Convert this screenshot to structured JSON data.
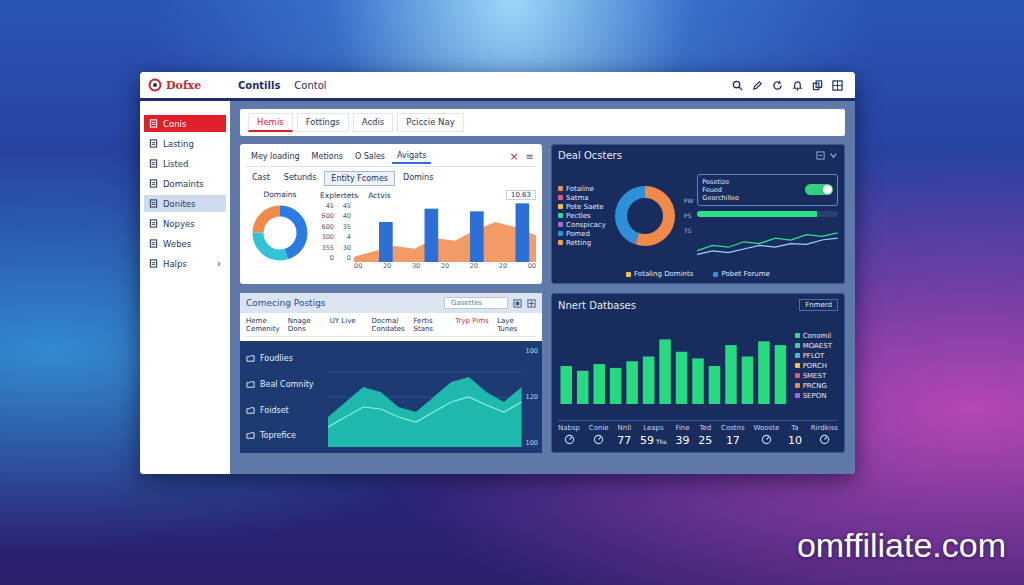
{
  "window": {
    "logo": "Dofxe",
    "nav": [
      {
        "label": "Contills",
        "selected": true
      },
      {
        "label": "Contol",
        "selected": false
      }
    ]
  },
  "sidebar": {
    "items": [
      {
        "label": "Conis",
        "selected": true,
        "highlighted": false
      },
      {
        "label": "Lasting",
        "selected": false,
        "highlighted": false
      },
      {
        "label": "Listed",
        "selected": false,
        "highlighted": false
      },
      {
        "label": "Domaints",
        "selected": false,
        "highlighted": false
      },
      {
        "label": "Donites",
        "selected": false,
        "highlighted": true
      },
      {
        "label": "Nopyes",
        "selected": false,
        "highlighted": false
      },
      {
        "label": "Webes",
        "selected": false,
        "highlighted": false
      },
      {
        "label": "Halps",
        "selected": false,
        "highlighted": false,
        "arrow": "›"
      }
    ]
  },
  "tabs": [
    {
      "label": "Hemis",
      "selected": true
    },
    {
      "label": "Fottings",
      "selected": false
    },
    {
      "label": "Acdis",
      "selected": false
    },
    {
      "label": "Pciccie Nay",
      "selected": false
    }
  ],
  "summary": {
    "tabs": [
      {
        "label": "Mey loading",
        "selected": false
      },
      {
        "label": "Metions",
        "selected": false
      },
      {
        "label": "O Sales",
        "selected": false
      },
      {
        "label": "Avigats",
        "selected": true
      }
    ],
    "close": "×",
    "menu": "≡",
    "subtabs": [
      {
        "label": "Cast",
        "selected": false
      },
      {
        "label": "Setunds",
        "selected": false
      },
      {
        "label": "Entity Fcomes",
        "selected": true
      },
      {
        "label": "Domins",
        "selected": false
      }
    ],
    "donut": {
      "title": "Domains",
      "segments": [
        {
          "value": 45,
          "color": "#2c7be5"
        },
        {
          "value": 30,
          "color": "#33c3d9"
        },
        {
          "value": 25,
          "color": "#f08a4b"
        }
      ]
    },
    "chart": {
      "title": "Explertets",
      "series_title": "Actvis",
      "select": "10.63",
      "ticks_outer": [
        "45",
        "600",
        "600",
        "300",
        "355",
        "0"
      ],
      "ticks_inner": [
        "45",
        "40",
        "35",
        "4",
        "30",
        "0"
      ],
      "x_labels": [
        "00",
        "20",
        "30",
        "20",
        "20",
        "20",
        "00"
      ],
      "max": 45,
      "bars": [
        30,
        40,
        38,
        44
      ],
      "area": [
        4,
        8,
        12,
        10,
        18,
        16,
        24,
        30,
        26,
        20
      ]
    }
  },
  "deals": {
    "title": "Deal Ocsters",
    "legend": [
      {
        "label": "Fotaline",
        "color": "#f08a4b"
      },
      {
        "label": "Satma",
        "color": "#e05a7a"
      },
      {
        "label": "Pote Saete",
        "color": "#f5c04a"
      },
      {
        "label": "Pectles",
        "color": "#2fd6a0"
      },
      {
        "label": "Conspicacy",
        "color": "#a06ae0"
      },
      {
        "label": "Pomed",
        "color": "#2f8fd8"
      },
      {
        "label": "Retting",
        "color": "#f0a24b"
      }
    ],
    "donut": {
      "segments": [
        {
          "value": 55,
          "color": "#f08a4b"
        },
        {
          "value": 45,
          "color": "#2f8fd8"
        }
      ],
      "labels": [
        "PW",
        "PS",
        "7S"
      ]
    },
    "footer_legend": [
      {
        "label": "Fotaling Domints",
        "color": "#f5c04a"
      },
      {
        "label": "Pobet Forume",
        "color": "#2f8fd8"
      }
    ],
    "info": {
      "lines": [
        "Posetize",
        "Feued",
        "Georchilleo"
      ],
      "toggle_on": true
    },
    "progress": {
      "level": 0.85
    },
    "line_chart": {
      "max": 100,
      "series": [
        {
          "values": [
            20,
            35,
            30,
            45,
            40,
            55,
            50,
            65,
            60,
            70
          ],
          "color": "#2fe08a"
        },
        {
          "values": [
            10,
            20,
            15,
            25,
            35,
            30,
            40,
            38,
            50,
            55
          ],
          "color": "#9bd0ff"
        }
      ]
    }
  },
  "postings": {
    "title": "Comecing Postigs",
    "search": {
      "placeholder": "Gasettes"
    },
    "columns": [
      {
        "label": "Heme Cemenity",
        "selected": false
      },
      {
        "label": "Nnage Dons",
        "selected": false
      },
      {
        "label": "UY Live",
        "selected": false
      },
      {
        "label": "Docmal Condates",
        "selected": false
      },
      {
        "label": "Fertis Stans",
        "selected": false
      },
      {
        "label": "Tryp Pims",
        "selected": true
      },
      {
        "label": "Laye Tunes",
        "selected": false
      }
    ],
    "items": [
      "Foudlies",
      "Beal Comnity",
      "Foidset",
      "Toprefice"
    ],
    "ticks": [
      "100",
      "120",
      "100"
    ],
    "max": 100,
    "area": [
      30,
      45,
      60,
      55,
      40,
      35,
      50,
      65,
      70,
      55,
      45,
      60
    ],
    "line": [
      20,
      30,
      40,
      38,
      30,
      25,
      35,
      45,
      50,
      42,
      35,
      45
    ]
  },
  "databases": {
    "title": "Nnert Datbases",
    "select": "Fnmerd",
    "max": 80,
    "bars": [
      40,
      35,
      42,
      38,
      45,
      50,
      68,
      55,
      48,
      40,
      62,
      50,
      66,
      62
    ],
    "legend": [
      {
        "label": "Conomil",
        "color": "#2fe08a"
      },
      {
        "label": "MOAEST",
        "color": "#2fd6a0"
      },
      {
        "label": "PFLOT",
        "color": "#33c3d9"
      },
      {
        "label": "PORCH",
        "color": "#f5c04a"
      },
      {
        "label": "SMEST",
        "color": "#e05a7a"
      },
      {
        "label": "PRCNG",
        "color": "#f08a4b"
      },
      {
        "label": "SEPON",
        "color": "#a06ae0"
      }
    ],
    "stats": [
      {
        "label": "Nabsp",
        "kind": "icon"
      },
      {
        "label": "Conie",
        "kind": "icon"
      },
      {
        "label": "Nnll",
        "kind": "number",
        "value": "77"
      },
      {
        "label": "Leaps",
        "kind": "number",
        "value": "59",
        "unit": "Ths"
      },
      {
        "label": "Fine",
        "kind": "number",
        "value": "39"
      },
      {
        "label": "Ted",
        "kind": "number",
        "value": "25"
      },
      {
        "label": "Costns",
        "kind": "number",
        "value": "17"
      },
      {
        "label": "Wooste",
        "kind": "icon"
      },
      {
        "label": "Ta",
        "kind": "number",
        "value": "10"
      },
      {
        "label": "Rirdkiss",
        "kind": "icon"
      }
    ]
  },
  "watermark": "omffiliate.com"
}
